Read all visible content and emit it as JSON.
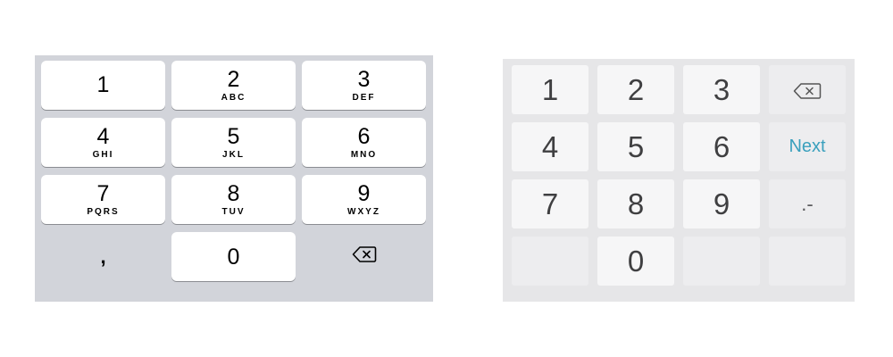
{
  "ios_keypad": {
    "keys": [
      {
        "digit": "1",
        "letters": ""
      },
      {
        "digit": "2",
        "letters": "ABC"
      },
      {
        "digit": "3",
        "letters": "DEF"
      },
      {
        "digit": "4",
        "letters": "GHI"
      },
      {
        "digit": "5",
        "letters": "JKL"
      },
      {
        "digit": "6",
        "letters": "MNO"
      },
      {
        "digit": "7",
        "letters": "PQRS"
      },
      {
        "digit": "8",
        "letters": "TUV"
      },
      {
        "digit": "9",
        "letters": "WXYZ"
      }
    ],
    "comma": ",",
    "zero": "0",
    "delete_icon": "backspace-icon"
  },
  "android_keypad": {
    "digits": [
      "1",
      "2",
      "3",
      "4",
      "5",
      "6",
      "7",
      "8",
      "9"
    ],
    "zero": "0",
    "next_label": "Next",
    "symbols_label": ".-",
    "delete_icon": "backspace-icon",
    "accent_color": "#3aa0bd"
  }
}
